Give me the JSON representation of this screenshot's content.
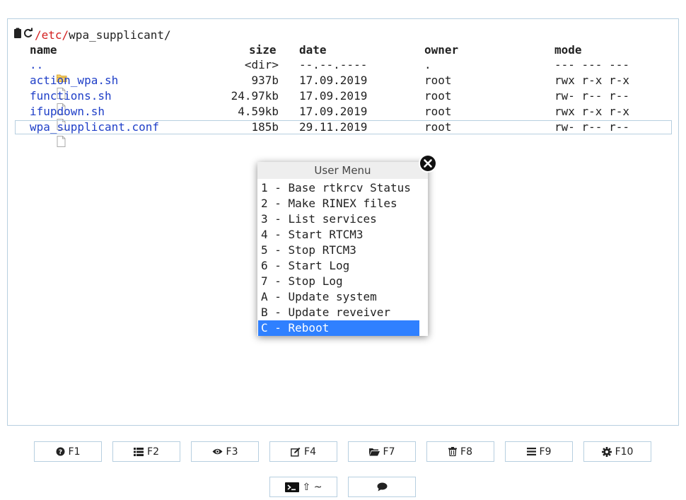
{
  "path": {
    "root": "/etc",
    "separator": "/",
    "current": "wpa_supplicant",
    "trailing": "/"
  },
  "table": {
    "headers": {
      "name": "name",
      "size": "size",
      "date": "date",
      "owner": "owner",
      "mode": "mode"
    },
    "rows": [
      {
        "icon": "folder-icon",
        "name": "..",
        "size": "<dir>",
        "date": "--.--.----",
        "owner": ".",
        "mode": "--- --- ---"
      },
      {
        "icon": "file-icon",
        "name": "action_wpa.sh",
        "size": "937b",
        "date": "17.09.2019",
        "owner": "root",
        "mode": "rwx r-x r-x"
      },
      {
        "icon": "file-icon",
        "name": "functions.sh",
        "size": "24.97kb",
        "date": "17.09.2019",
        "owner": "root",
        "mode": "rw- r-- r--"
      },
      {
        "icon": "file-icon",
        "name": "ifupdown.sh",
        "size": "4.59kb",
        "date": "17.09.2019",
        "owner": "root",
        "mode": "rwx r-x r-x"
      },
      {
        "icon": "file-icon",
        "name": "wpa_supplicant.conf",
        "size": "185b",
        "date": "29.11.2019",
        "owner": "root",
        "mode": "rw- r-- r--"
      }
    ],
    "selected_index": 4
  },
  "menu": {
    "title": "User Menu",
    "items": [
      "1 - Base rtkrcv Status",
      "2 - Make RINEX files",
      "3 - List services",
      "4 - Start RTCM3",
      "5 - Stop RTCM3",
      "6 - Start Log",
      "7 - Stop Log",
      "A - Update system",
      "B - Update reveiver",
      "C - Reboot"
    ],
    "active_index": 9
  },
  "buttons": {
    "f1": "F1",
    "f2": "F2",
    "f3": "F3",
    "f4": "F4",
    "f7": "F7",
    "f8": "F8",
    "f9": "F9",
    "f10": "F10",
    "terminal": "⇧ ~"
  },
  "colors": {
    "accent": "#2f80ff",
    "file_link": "#1f3fc8",
    "path_root": "#d32020",
    "border": "#b7cfe0",
    "folder": "#f2c14e"
  }
}
